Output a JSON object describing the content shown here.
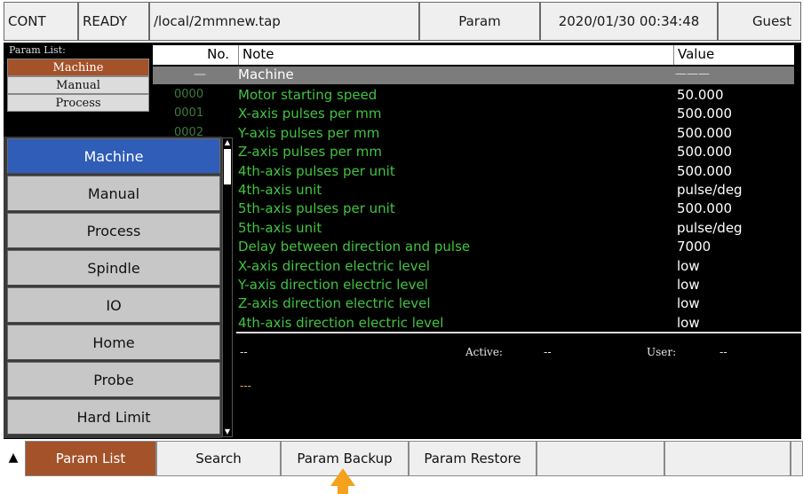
{
  "status_bar": {
    "mode": "CONT",
    "state": "READY",
    "file": "/local/2mmnew.tap",
    "screen": "Param",
    "datetime": "2020/01/30 00:34:48",
    "user": "Guest"
  },
  "left_list": {
    "title": "Param List:",
    "items": [
      "Machine",
      "Manual",
      "Process"
    ],
    "active_index": 0
  },
  "table": {
    "headers": {
      "no": "No.",
      "note": "Note",
      "value": "Value"
    },
    "group": {
      "no": "—",
      "note": "Machine",
      "value": "———"
    },
    "rows": [
      {
        "no": "0000",
        "note": "Motor starting speed",
        "value": "50.000"
      },
      {
        "no": "0001",
        "note": "X-axis pulses per mm",
        "value": "500.000"
      },
      {
        "no": "0002",
        "note": "Y-axis pulses per mm",
        "value": "500.000"
      },
      {
        "no": "",
        "note": "Z-axis pulses per mm",
        "value": "500.000"
      },
      {
        "no": "",
        "note": "4th-axis pulses per unit",
        "value": "500.000"
      },
      {
        "no": "",
        "note": "4th-axis unit",
        "value": "pulse/deg"
      },
      {
        "no": "",
        "note": "5th-axis pulses per unit",
        "value": "500.000"
      },
      {
        "no": "",
        "note": "5th-axis unit",
        "value": "pulse/deg"
      },
      {
        "no": "",
        "note": "Delay between direction and pulse",
        "value": "7000"
      },
      {
        "no": "",
        "note": "X-axis direction electric level",
        "value": "low"
      },
      {
        "no": "",
        "note": "Y-axis direction electric level",
        "value": "low"
      },
      {
        "no": "",
        "note": "Z-axis direction electric level",
        "value": "low"
      },
      {
        "no": "",
        "note": "4th-axis direction electric level",
        "value": "low"
      }
    ]
  },
  "status_area": {
    "line1": "--",
    "active_label": "Active:",
    "active_value": "--",
    "user_label": "User:",
    "user_value": "--",
    "line2": "---"
  },
  "menu": {
    "items": [
      "Machine",
      "Manual",
      "Process",
      "Spindle",
      "IO",
      "Home",
      "Probe",
      "Hard Limit"
    ],
    "active_index": 0
  },
  "softkeys": {
    "up": "▲",
    "param_list": "Param List",
    "search": "Search",
    "param_backup": "Param Backup",
    "param_restore": "Param Restore"
  },
  "colors": {
    "accent_orange": "#a4522a",
    "menu_selected": "#2f5db8",
    "note_green": "#41c441",
    "pointer_arrow": "#f4a11b"
  },
  "icons": {
    "pointer": "up-arrow-pointer-icon",
    "scroll_up": "triangle-up-icon",
    "scroll_down": "triangle-down-icon"
  }
}
